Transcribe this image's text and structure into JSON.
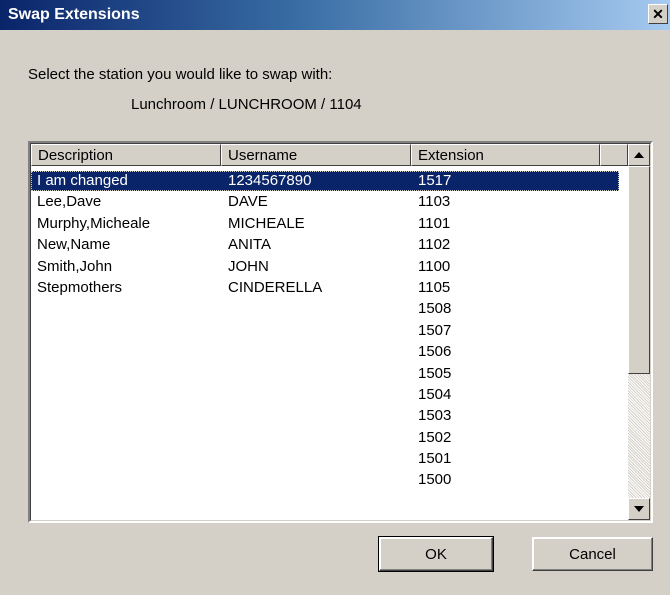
{
  "window": {
    "title": "Swap Extensions",
    "close_glyph": "✕"
  },
  "dialog": {
    "prompt": "Select the station you would like to swap with:",
    "current_station": "Lunchroom / LUNCHROOM / 1104"
  },
  "list": {
    "columns": [
      "Description",
      "Username",
      "Extension"
    ],
    "selected_index": 0,
    "rows": [
      {
        "description": "I am changed",
        "username": "1234567890",
        "extension": "1517"
      },
      {
        "description": "Lee,Dave",
        "username": "DAVE",
        "extension": "1103"
      },
      {
        "description": "Murphy,Micheale",
        "username": "MICHEALE",
        "extension": "1101"
      },
      {
        "description": "New,Name",
        "username": "ANITA",
        "extension": "1102"
      },
      {
        "description": "Smith,John",
        "username": "JOHN",
        "extension": "1100"
      },
      {
        "description": "Stepmothers",
        "username": "CINDERELLA",
        "extension": "1105"
      },
      {
        "description": "",
        "username": "",
        "extension": "1508"
      },
      {
        "description": "",
        "username": "",
        "extension": "1507"
      },
      {
        "description": "",
        "username": "",
        "extension": "1506"
      },
      {
        "description": "",
        "username": "",
        "extension": "1505"
      },
      {
        "description": "",
        "username": "",
        "extension": "1504"
      },
      {
        "description": "",
        "username": "",
        "extension": "1503"
      },
      {
        "description": "",
        "username": "",
        "extension": "1502"
      },
      {
        "description": "",
        "username": "",
        "extension": "1501"
      },
      {
        "description": "",
        "username": "",
        "extension": "1500"
      }
    ],
    "scrollbar": {
      "up_icon": "scroll-up-arrow-icon",
      "down_icon": "scroll-down-arrow-icon"
    }
  },
  "buttons": {
    "ok": "OK",
    "cancel": "Cancel"
  },
  "colors": {
    "selection": "#0a246a",
    "titlebar": "#0a246a",
    "face": "#d4d0c8"
  }
}
